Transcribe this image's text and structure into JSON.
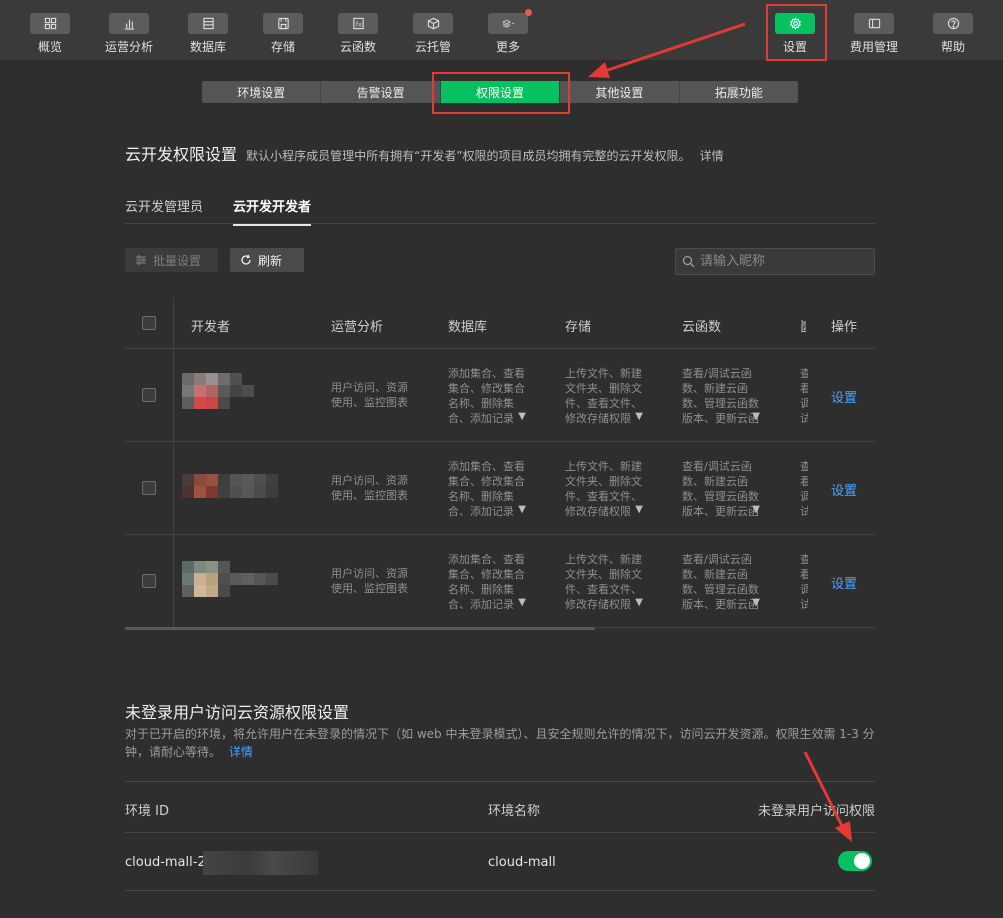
{
  "toolbar": {
    "items": [
      {
        "label": "概览",
        "icon": "grid-icon"
      },
      {
        "label": "运营分析",
        "icon": "chart-icon"
      },
      {
        "label": "数据库",
        "icon": "database-icon"
      },
      {
        "label": "存储",
        "icon": "storage-icon"
      },
      {
        "label": "云函数",
        "icon": "function-icon"
      },
      {
        "label": "云托管",
        "icon": "box-icon"
      },
      {
        "label": "更多",
        "icon": "layers-icon"
      }
    ],
    "right_items": [
      {
        "label": "设置",
        "icon": "gear-icon",
        "active": true
      },
      {
        "label": "费用管理",
        "icon": "billing-icon"
      },
      {
        "label": "帮助",
        "icon": "help-icon"
      }
    ],
    "accent": "#07c160",
    "badge_color": "#f25555"
  },
  "segment_tabs": [
    "环境设置",
    "告警设置",
    "权限设置",
    "其他设置",
    "拓展功能"
  ],
  "page": {
    "title": "云开发权限设置",
    "desc": "默认小程序成员管理中所有拥有“开发者”权限的项目成员均拥有完整的云开发权限。",
    "detail_link": "详情"
  },
  "sub_tabs": [
    "云开发管理员",
    "云开发开发者"
  ],
  "buttons": {
    "batch": "批量设置",
    "refresh": "刷新"
  },
  "search": {
    "placeholder": "请输入昵称"
  },
  "table": {
    "headers": [
      "开发者",
      "运营分析",
      "数据库",
      "存储",
      "云函数",
      "操作"
    ],
    "rows": [
      {
        "analytics": "用户访问、资源使用、监控图表",
        "database": "添加集合、查看集合、修改集合名称、删除集合、添加记录",
        "storage": "上传文件、新建文件夹、删除文件、查看文件、修改存储权限",
        "functions": "查看/调试云函数、新建云函数、管理云函数版本、更新云函数",
        "more": "查看/调试",
        "action": "设置"
      },
      {
        "analytics": "用户访问、资源使用、监控图表",
        "database": "添加集合、查看集合、修改集合名称、删除集合、添加记录",
        "storage": "上传文件、新建文件夹、删除文件、查看文件、修改存储权限",
        "functions": "查看/调试云函数、新建云函数、管理云函数版本、更新云函数",
        "more": "查看/调试",
        "action": "设置"
      },
      {
        "analytics": "用户访问、资源使用、监控图表",
        "database": "添加集合、查看集合、修改集合名称、删除集合、添加记录",
        "storage": "上传文件、新建文件夹、删除文件、查看文件、修改存储权限",
        "functions": "查看/调试云函数、新建云函数、管理云函数版本、更新云函数",
        "more": "查看/调试",
        "action": "设置"
      }
    ]
  },
  "unauth": {
    "title": "未登录用户访问云资源权限设置",
    "desc": "对于已开启的环境，将允许用户在未登录的情况下（如 web 中未登录模式）、且安全规则允许的情况下，访问云开发资源。权限生效需 1-3 分钟，请耐心等待。",
    "detail_link": "详情",
    "headers": [
      "环境 ID",
      "环境名称",
      "未登录用户访问权限"
    ],
    "row": {
      "env_id": "cloud-mall-2c",
      "env_name": "cloud-mall",
      "enabled": true
    }
  },
  "annotation_color": "#e53935"
}
